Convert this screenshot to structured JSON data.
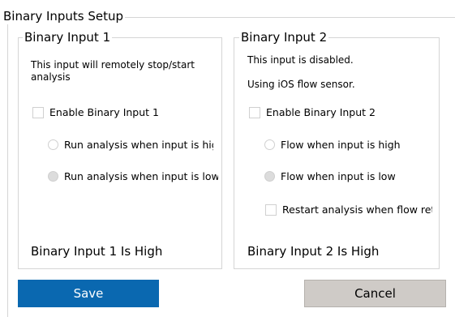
{
  "title": "Binary Inputs Setup",
  "input1": {
    "title": "Binary Input 1",
    "description": "This input will remotely stop/start analysis",
    "enable_label": "Enable Binary Input 1",
    "radio_high": "Run analysis when input is high",
    "radio_low": "Run analysis when input is low",
    "enabled": false,
    "selected_radio": "low",
    "status": "Binary Input 1 Is High"
  },
  "input2": {
    "title": "Binary Input 2",
    "disabled_note": "This input is disabled.",
    "sensor_note": "Using iOS flow sensor.",
    "enable_label": "Enable Binary Input 2",
    "radio_high": "Flow when input is high",
    "radio_low": "Flow when input is low",
    "restart_label": "Restart analysis when flow returns",
    "enabled": false,
    "selected_radio": "low",
    "restart_checked": false,
    "status": "Binary Input 2 Is High"
  },
  "buttons": {
    "save": "Save",
    "cancel": "Cancel"
  },
  "colors": {
    "save_button": "#0a68b0",
    "cancel_button": "#cfcbc7"
  }
}
